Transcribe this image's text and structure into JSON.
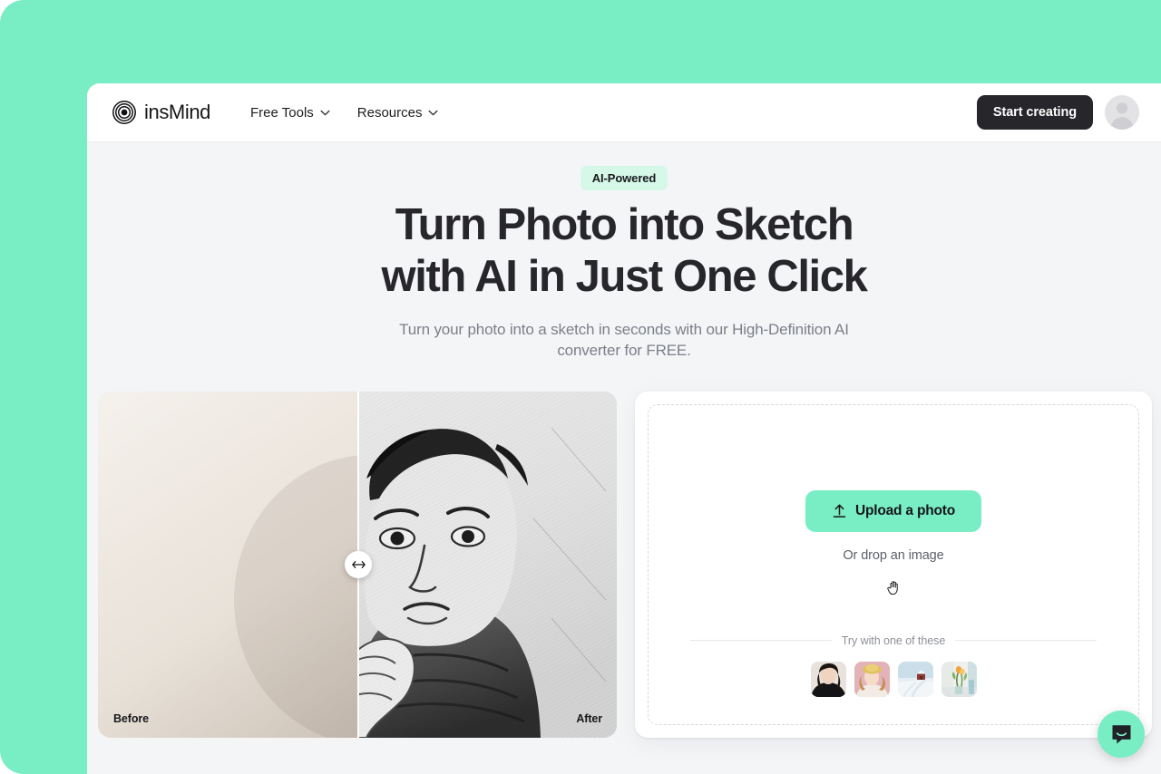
{
  "theme": {
    "mint": "#79edc4",
    "badge_bg": "#d5f8e8",
    "dark": "#26262b",
    "page_bg": "#f4f5f7",
    "muted_text": "#7c7f88"
  },
  "header": {
    "brand_name": "insMind",
    "logo_icon": "concentric-rings-logo",
    "nav": [
      {
        "label": "Free Tools",
        "icon": "chevron-down-icon"
      },
      {
        "label": "Resources",
        "icon": "chevron-down-icon"
      }
    ],
    "cta_label": "Start creating",
    "avatar_icon": "user-avatar-placeholder"
  },
  "hero": {
    "badge": "AI-Powered",
    "headline_line1": "Turn Photo into Sketch",
    "headline_line2": "with AI in Just One Click",
    "subhead": "Turn your photo into a sketch in seconds with our High-Definition AI converter for FREE."
  },
  "comparison": {
    "before_label": "Before",
    "after_label": "After",
    "handle_icon": "left-right-arrow-icon",
    "divider_position_percent": 50
  },
  "upload": {
    "button_label": "Upload a photo",
    "button_icon": "upload-arrow-icon",
    "drop_text": "Or drop an image",
    "cursor_icon": "hand-cursor-icon",
    "try_label": "Try with one of these",
    "samples": [
      {
        "name": "woman-in-black-portrait"
      },
      {
        "name": "woman-with-hat-portrait"
      },
      {
        "name": "snowy-barn-landscape"
      },
      {
        "name": "flowers-on-desk"
      }
    ]
  },
  "chat": {
    "icon": "chat-bubble-smile-icon"
  }
}
